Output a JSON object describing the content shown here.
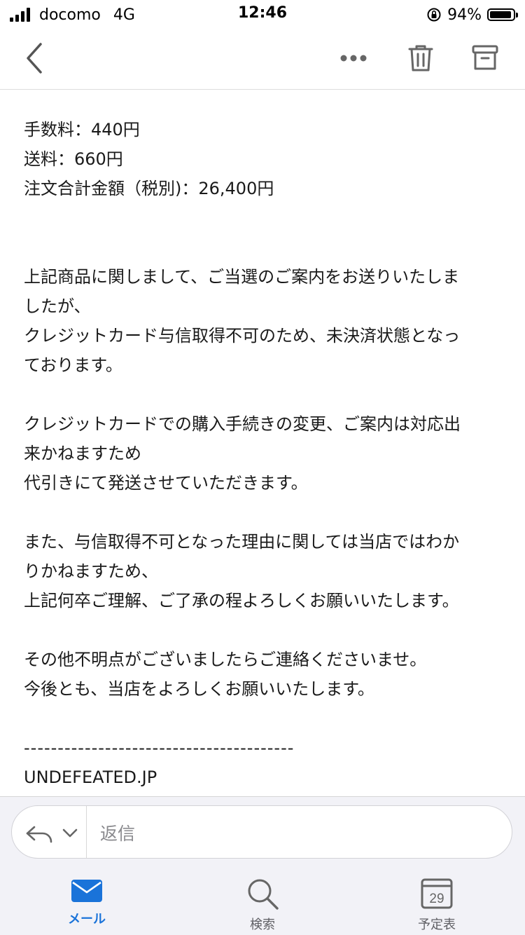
{
  "status_bar": {
    "carrier": "docomo",
    "network": "4G",
    "time": "12:46",
    "battery_percent": "94%"
  },
  "nav": {
    "back_icon": "chevron-left-icon",
    "more_icon": "ellipsis-icon",
    "trash_icon": "trash-icon",
    "archive_icon": "archive-icon"
  },
  "mail": {
    "fee_line": "手数料：440円",
    "shipping_line": "送料：660円",
    "total_line": "注文合計金額（税別)：26,400円",
    "para1_line1": "上記商品に関しまして、ご当選のご案内をお送りいたしま",
    "para1_line2": "したが、",
    "para1_line3": "クレジットカード与信取得不可のため、未決済状態となっ",
    "para1_line4": "ております。",
    "para2_line1": "クレジットカードでの購入手続きの変更、ご案内は対応出",
    "para2_line2": "来かねますため",
    "para2_line3": "代引きにて発送させていただきます。",
    "para3_line1": "また、与信取得不可となった理由に関しては当店ではわか",
    "para3_line2": "りかねますため、",
    "para3_line3": "上記何卒ご理解、ご了承の程よろしくお願いいたします。",
    "para4_line1": "その他不明点がございましたらご連絡くださいませ。",
    "para4_line2": "今後とも、当店をよろしくお願いいたします。",
    "divider": "----------------------------------------",
    "signature": "UNDEFEATED.JP"
  },
  "reply": {
    "label": "返信"
  },
  "tabs": [
    {
      "label": "メール",
      "icon": "mail-icon",
      "active": true
    },
    {
      "label": "検索",
      "icon": "search-icon",
      "active": false
    },
    {
      "label": "予定表",
      "icon": "calendar-icon",
      "day": "29",
      "active": false
    }
  ],
  "colors": {
    "accent": "#1a73d9"
  }
}
